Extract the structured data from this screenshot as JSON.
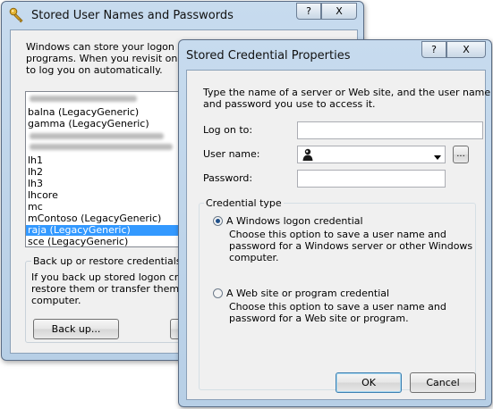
{
  "back_dialog": {
    "title": "Stored User Names and Passwords",
    "help_btn": "?",
    "close_btn": "X",
    "intro_lines": [
      "Windows can store your logon cred",
      "programs. When you revisit one of",
      "to log you on automatically."
    ],
    "list_items": [
      "balna (LegacyGeneric)",
      "gamma (LegacyGeneric)",
      "lh1",
      "lh2",
      "lh3",
      "lhcore",
      "mc",
      "mContoso (LegacyGeneric)",
      "raja (LegacyGeneric)",
      "sce (LegacyGeneric)"
    ],
    "backup": {
      "title": "Back up or restore credentials",
      "lines": [
        "If you back up stored logon crede",
        "restore them or transfer them to",
        "computer."
      ],
      "backup_button": "Back up..."
    }
  },
  "front_dialog": {
    "title": "Stored Credential Properties",
    "help_btn": "?",
    "close_btn": "X",
    "instructions_lines": [
      "Type the name of a server or Web site, and the user name",
      "and password you use to access it."
    ],
    "logon_label": "Log on to:",
    "logon_value": "",
    "username_label": "User name:",
    "username_value": "",
    "browse_button": "...",
    "password_label": "Password:",
    "password_value": "",
    "credential_type_label": "Credential type",
    "windows_option": {
      "label": "A Windows logon credential",
      "selected": true,
      "description_lines": [
        "Choose this option to save a user name and",
        "password for a Windows server or other Windows",
        "computer."
      ]
    },
    "web_option": {
      "label": "A Web site or program credential",
      "selected": false,
      "description_lines": [
        "Choose this option to save a user name and",
        "password for a Web site or program."
      ]
    },
    "ok_button": "OK",
    "cancel_button": "Cancel"
  }
}
